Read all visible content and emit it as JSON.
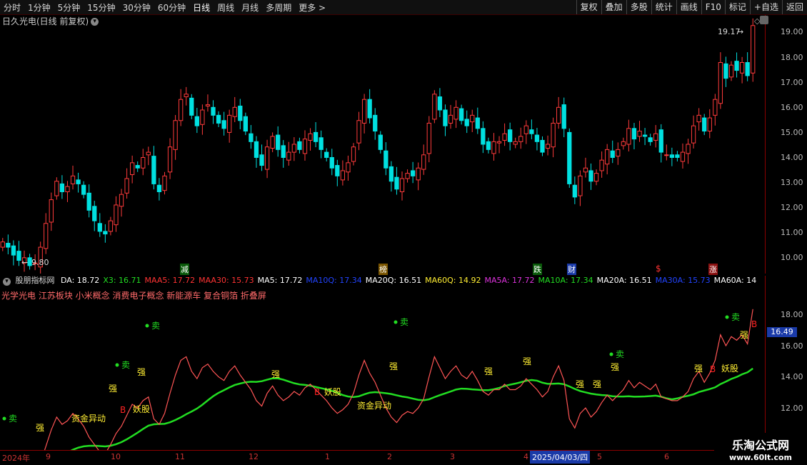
{
  "toolbar": {
    "periods": [
      "分时",
      "1分钟",
      "5分钟",
      "15分钟",
      "30分钟",
      "60分钟",
      "日线",
      "周线",
      "月线",
      "多周期",
      "更多 >"
    ],
    "active_period": "日线",
    "right_buttons": [
      "复权",
      "叠加",
      "多股",
      "统计",
      "画线",
      "F10",
      "标记",
      "+自选",
      "返回"
    ]
  },
  "main": {
    "title": "日久光电(日线 前复权)",
    "high_marker": "19.17",
    "low_marker": "9.80",
    "y_ticks": [
      "19.00",
      "18.00",
      "17.00",
      "16.00",
      "15.00",
      "14.00",
      "13.00",
      "12.00",
      "11.00",
      "10.00"
    ],
    "event_markers": [
      "减",
      "榜",
      "跌",
      "财",
      "$",
      "涨"
    ]
  },
  "indicator": {
    "name": "股朋指标网",
    "values": [
      {
        "label": "DA: 18.72",
        "color": "#ffffff"
      },
      {
        "label": "X3: 16.71",
        "color": "#22dd22"
      },
      {
        "label": "MAA5: 17.72",
        "color": "#ff3333"
      },
      {
        "label": "MAA30: 15.73",
        "color": "#ff3333"
      },
      {
        "label": "MA5: 17.72",
        "color": "#ffffff"
      },
      {
        "label": "MA10Q: 17.34",
        "color": "#2244ff"
      },
      {
        "label": "MA20Q: 16.51",
        "color": "#ffffff"
      },
      {
        "label": "MA60Q: 14.92",
        "color": "#ffee33"
      },
      {
        "label": "MA5A: 17.72",
        "color": "#dd33dd"
      },
      {
        "label": "MA10A: 17.34",
        "color": "#22dd22"
      },
      {
        "label": "MA20A: 16.51",
        "color": "#ffffff"
      },
      {
        "label": "MA30A: 15.73",
        "color": "#2244ff"
      },
      {
        "label": "MA60A: 14",
        "color": "#ffffff"
      }
    ],
    "concepts": "光学光电 江苏板块 小米概念 消费电子概念 新能源车 复合铜箔 折叠屏",
    "y_ticks": [
      "18.00",
      "16.00",
      "14.00",
      "12.00"
    ],
    "current_price": "16.49",
    "labels": {
      "sell": "卖",
      "strong": "强",
      "buy": "B",
      "monster": "妖股",
      "fund": "资金异动"
    }
  },
  "xaxis": {
    "labels": [
      "2024年",
      "9",
      "10",
      "11",
      "12",
      "1",
      "2",
      "3",
      "4",
      "2025/04/03/四",
      "5",
      "6"
    ]
  },
  "watermark": {
    "name": "乐淘公式网",
    "url": "www.60lt.com"
  },
  "chart_data": {
    "type": "candlestick",
    "title": "日久光电(日线 前复权)",
    "ylim": [
      9.6,
      19.4
    ],
    "series": [
      {
        "name": "close",
        "values": [
          10.8,
          10.6,
          10.3,
          10.1,
          10.2,
          9.9,
          10.0,
          10.6,
          11.5,
          12.4,
          13.1,
          12.7,
          12.9,
          13.3,
          13.0,
          12.6,
          12.0,
          11.6,
          11.2,
          11.1,
          11.6,
          12.2,
          12.6,
          13.2,
          13.8,
          13.6,
          14.0,
          14.2,
          13.0,
          12.7,
          13.3,
          14.4,
          15.4,
          16.2,
          16.4,
          15.6,
          15.2,
          15.8,
          16.0,
          15.6,
          15.3,
          15.1,
          15.6,
          15.9,
          15.4,
          15.0,
          14.6,
          14.0,
          13.7,
          14.4,
          14.8,
          14.3,
          14.0,
          14.2,
          14.5,
          14.3,
          14.7,
          14.9,
          14.6,
          14.3,
          14.0,
          13.6,
          13.3,
          13.5,
          13.8,
          14.4,
          15.4,
          16.2,
          15.5,
          15.0,
          14.3,
          13.6,
          13.1,
          12.8,
          13.2,
          13.4,
          13.3,
          13.6,
          14.1,
          15.3,
          16.4,
          15.8,
          15.2,
          15.6,
          15.9,
          15.4,
          15.2,
          15.6,
          15.1,
          14.5,
          14.3,
          14.6,
          14.6,
          14.9,
          14.6,
          14.6,
          14.8,
          15.2,
          14.9,
          14.6,
          14.2,
          14.5,
          15.3,
          15.9,
          15.1,
          13.0,
          12.5,
          13.3,
          13.6,
          13.1,
          13.4,
          13.9,
          14.3,
          14.0,
          14.3,
          14.6,
          15.1,
          14.7,
          15.0,
          14.8,
          14.6,
          14.9,
          14.2,
          14.1,
          14.0,
          14.0,
          14.2,
          14.5,
          15.2,
          15.6,
          15.0,
          15.5,
          16.2,
          17.6,
          17.0,
          17.5,
          17.3,
          17.6,
          17.1,
          19.0
        ]
      }
    ]
  }
}
